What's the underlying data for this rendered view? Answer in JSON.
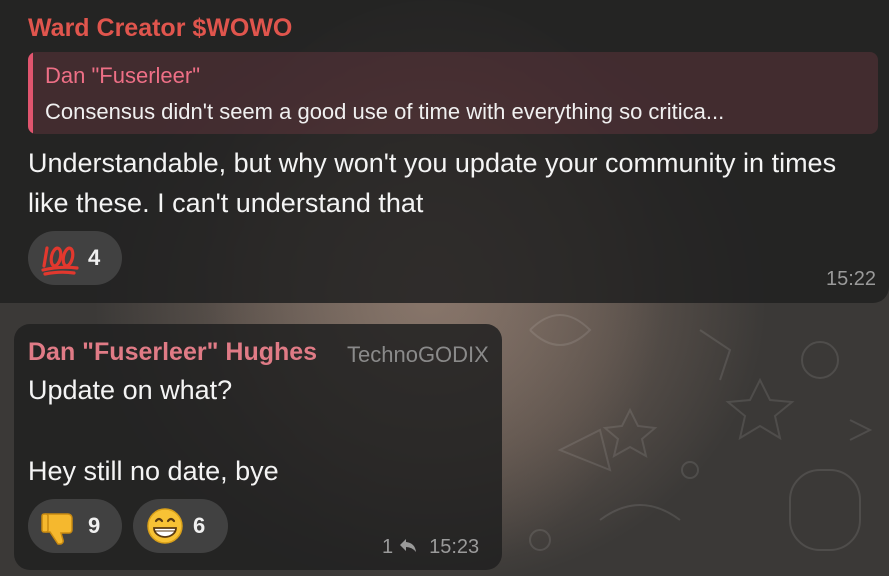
{
  "messages": [
    {
      "sender": "Ward Creator $WOWO",
      "reply": {
        "name": "Dan \"Fuserleer\"",
        "text": "Consensus didn't seem a good use of time with everything so critica..."
      },
      "text": "Understandable, but why won't you update your community in times like these. I can't understand that",
      "reactions": [
        {
          "icon": "hundred-points-icon",
          "count": "4"
        }
      ],
      "time": "15:22"
    },
    {
      "sender": "Dan \"Fuserleer\" Hughes",
      "badge": "TechnoGODIX",
      "lines": [
        "Update on what?",
        "Hey still no date, bye"
      ],
      "reactions": [
        {
          "icon": "thumbs-down-icon",
          "count": "9"
        },
        {
          "icon": "grinning-face-icon",
          "count": "6"
        }
      ],
      "replies_count": "1",
      "time": "15:23"
    }
  ],
  "colors": {
    "sender1": "#e0554d",
    "sender2": "#e07b86",
    "reply_accent": "#e0556e",
    "bubble": "#212121"
  }
}
